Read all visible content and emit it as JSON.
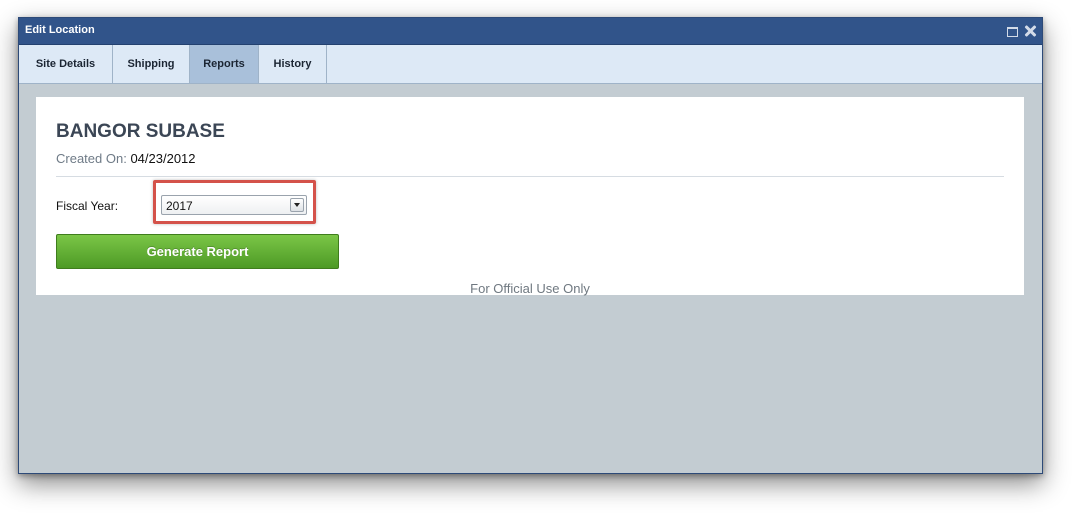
{
  "window": {
    "title": "Edit Location"
  },
  "tabs": [
    {
      "label": "Site Details",
      "active": false
    },
    {
      "label": "Shipping",
      "active": false
    },
    {
      "label": "Reports",
      "active": true
    },
    {
      "label": "History",
      "active": false
    }
  ],
  "panel": {
    "site_name": "BANGOR SUBASE",
    "created_label": "Created On:",
    "created_date": "04/23/2012",
    "fiscal_year_label": "Fiscal Year:",
    "fiscal_year_selected": "2017",
    "generate_button": "Generate Report",
    "footer_note": "For Official Use Only"
  },
  "colors": {
    "titlebar": "#31548a",
    "tabbar": "#dde9f6",
    "active_tab": "#a9c0da",
    "button_green": "#5fae31",
    "highlight_red": "#d4524a"
  }
}
